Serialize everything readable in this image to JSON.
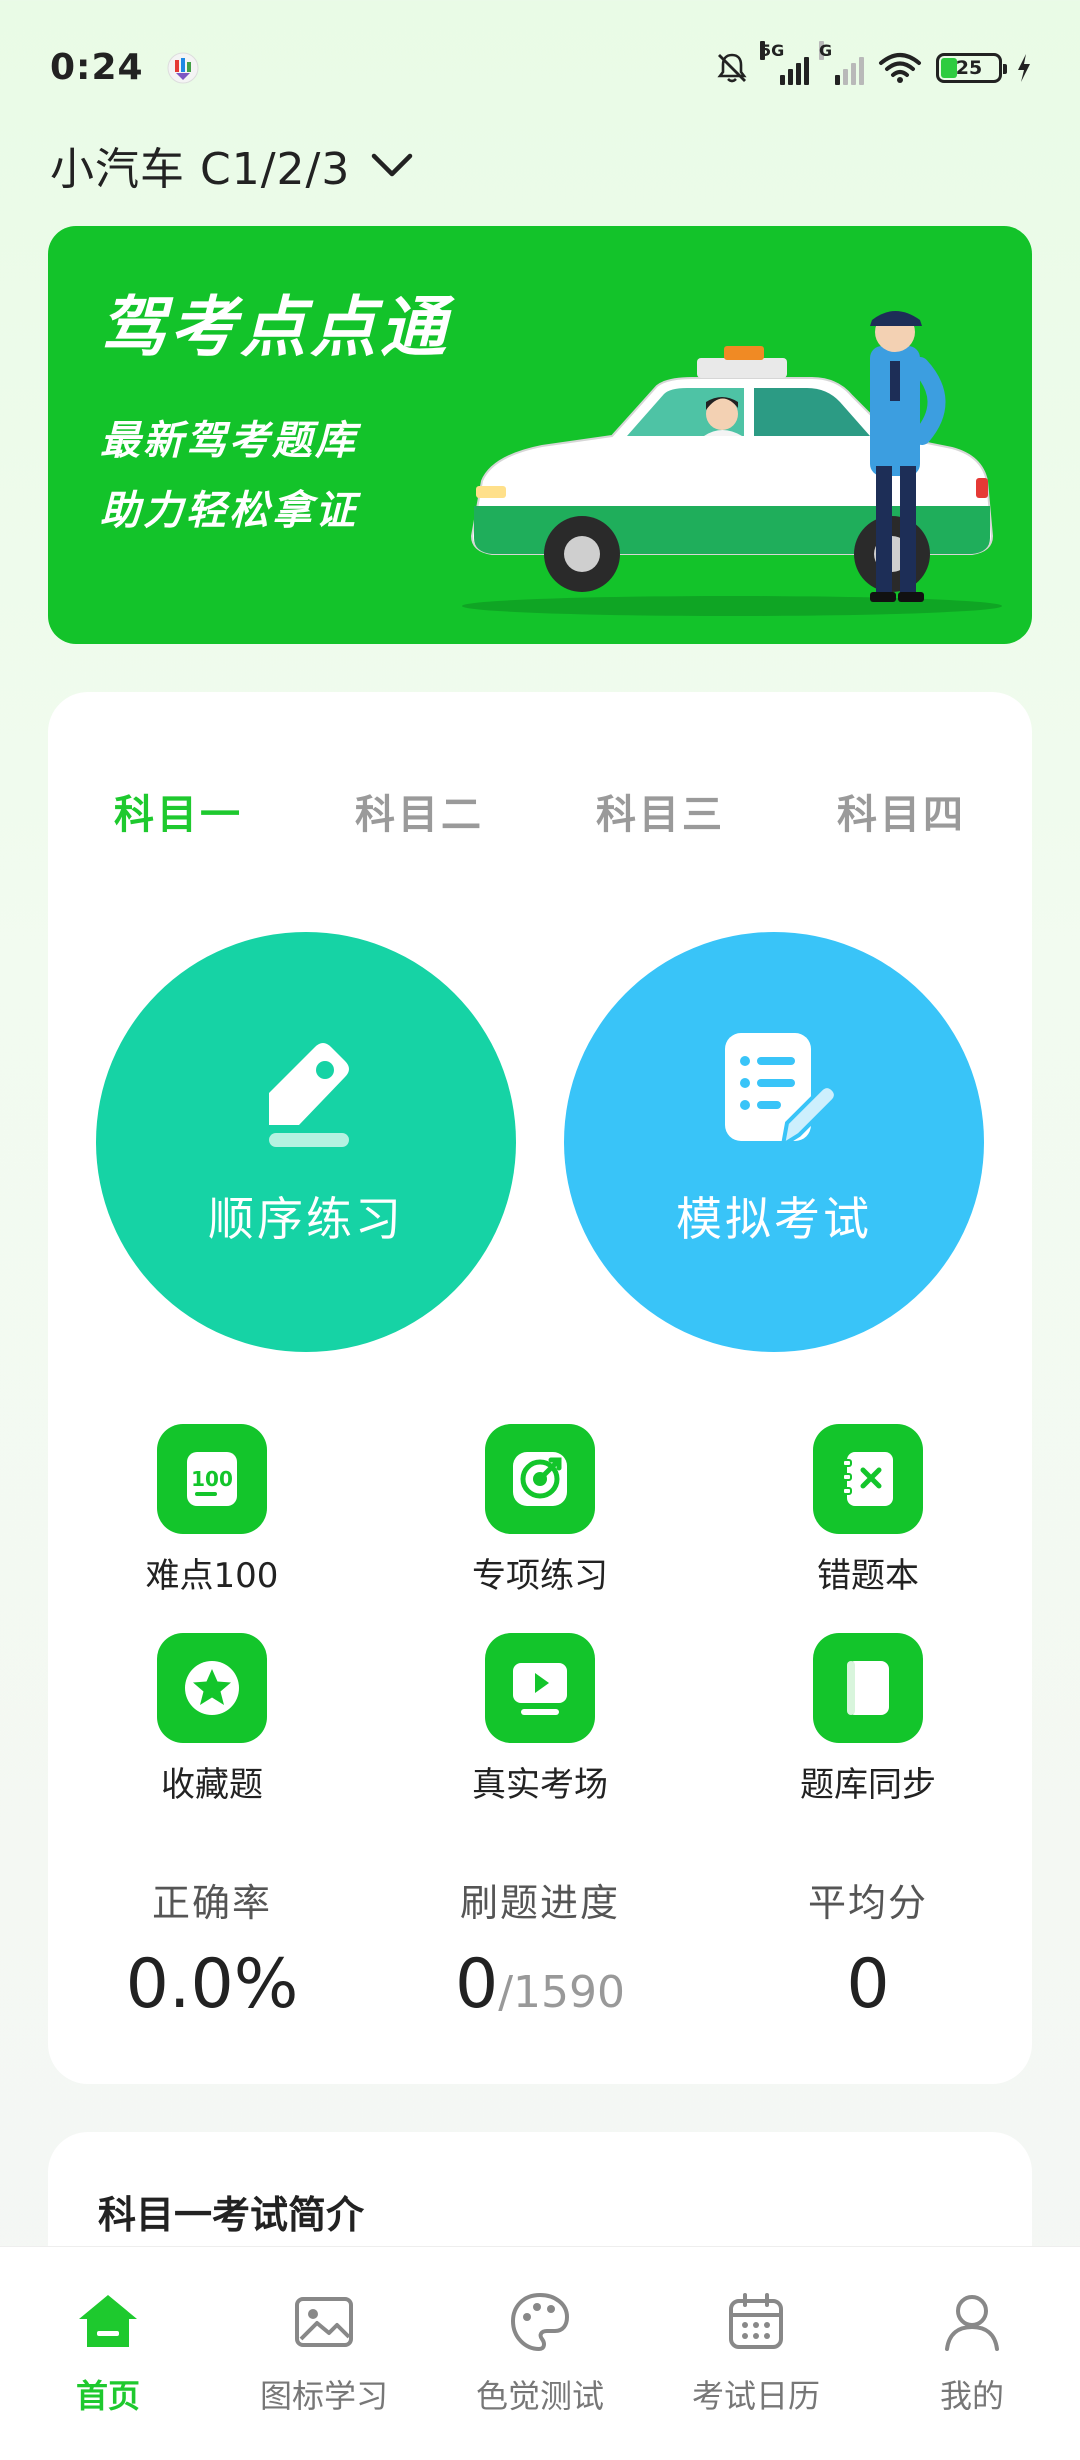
{
  "status_bar": {
    "time": "0:24",
    "network_1": "5G",
    "network_2": "G",
    "battery": "25"
  },
  "header": {
    "title": "小汽车 C1/2/3"
  },
  "banner": {
    "title": "驾考点点通",
    "line1": "最新驾考题库",
    "line2": "助力轻松拿证"
  },
  "tabs": [
    {
      "label": "科目一",
      "active": true
    },
    {
      "label": "科目二",
      "active": false
    },
    {
      "label": "科目三",
      "active": false
    },
    {
      "label": "科目四",
      "active": false
    }
  ],
  "primary_actions": {
    "sequential_label": "顺序练习",
    "mock_exam_label": "模拟考试"
  },
  "features": [
    {
      "label": "难点100",
      "icon": "hard-100-icon"
    },
    {
      "label": "专项练习",
      "icon": "target-icon"
    },
    {
      "label": "错题本",
      "icon": "mistake-book-icon"
    },
    {
      "label": "收藏题",
      "icon": "star-icon"
    },
    {
      "label": "真实考场",
      "icon": "video-play-icon"
    },
    {
      "label": "题库同步",
      "icon": "sync-icon"
    }
  ],
  "stats": {
    "accuracy_label": "正确率",
    "accuracy_value": "0.0%",
    "progress_label": "刷题进度",
    "progress_done": "0",
    "progress_total": "/1590",
    "average_label": "平均分",
    "average_value": "0"
  },
  "intro": {
    "title": "科目一考试简介"
  },
  "bottom_nav": [
    {
      "label": "首页",
      "icon": "home-icon",
      "active": true
    },
    {
      "label": "图标学习",
      "icon": "image-icon",
      "active": false
    },
    {
      "label": "色觉测试",
      "icon": "palette-icon",
      "active": false
    },
    {
      "label": "考试日历",
      "icon": "calendar-icon",
      "active": false
    },
    {
      "label": "我的",
      "icon": "user-icon",
      "active": false
    }
  ],
  "colors": {
    "accent": "#1ec92e",
    "banner_bg": "#13c32a",
    "sequential_bg": "#16d3a5",
    "mock_exam_bg": "#39c4f8"
  }
}
